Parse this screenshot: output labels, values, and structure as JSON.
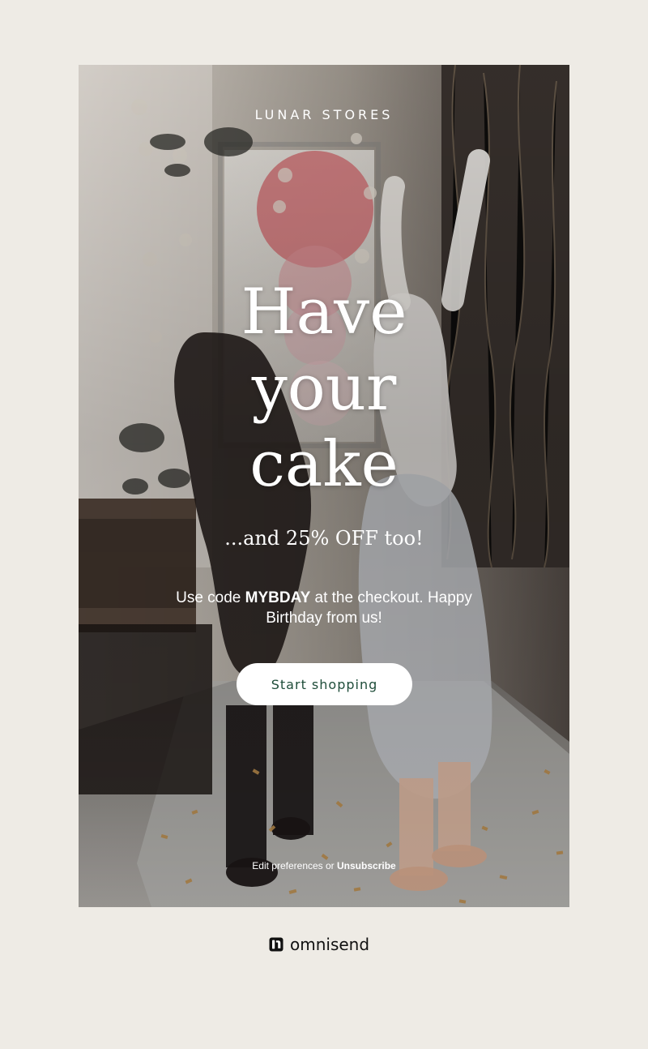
{
  "email": {
    "brand": "LUNAR STORES",
    "headline": [
      "Have",
      "your",
      "cake"
    ],
    "subhead": "...and 25% OFF too!",
    "body_prefix": "Use code ",
    "promo_code": "MYBDAY",
    "body_suffix": " at the checkout. Happy Birthday from us!",
    "cta_label": "Start shopping",
    "prefs_prefix": "Edit preferences",
    "prefs_or": " or ",
    "unsubscribe": "Unsubscribe"
  },
  "footer": {
    "powered_by": "omnisend",
    "icon": "omnisend-logo-icon"
  },
  "colors": {
    "page_background": "#eeebe5",
    "cta_background": "#ffffff",
    "cta_text": "#1f4d3a",
    "text_on_image": "#ffffff"
  }
}
